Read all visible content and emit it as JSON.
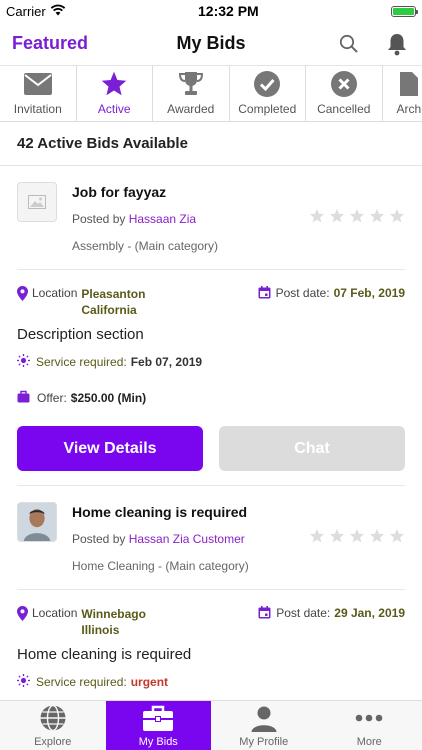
{
  "status": {
    "carrier": "Carrier",
    "time": "12:32 PM"
  },
  "nav": {
    "left": "Featured",
    "title": "My Bids"
  },
  "tabs": [
    {
      "label": "Invitation",
      "icon": "envelope-icon"
    },
    {
      "label": "Active",
      "icon": "star-icon"
    },
    {
      "label": "Awarded",
      "icon": "trophy-icon"
    },
    {
      "label": "Completed",
      "icon": "check-circle-icon"
    },
    {
      "label": "Cancelled",
      "icon": "x-circle-icon"
    },
    {
      "label": "Arch",
      "icon": "archive-icon"
    }
  ],
  "count_text": "42 Active Bids Available",
  "bids": [
    {
      "title": "Job for fayyaz",
      "posted_label": "Posted by",
      "poster": "Hassaan Zia",
      "category": "Assembly - (Main category)",
      "location_label": "Location",
      "location_line1": "Pleasanton",
      "location_line2": "California",
      "post_date_label": "Post date:",
      "post_date": "07 Feb, 2019",
      "description": "Description section",
      "service_label": "Service required:",
      "service_value": "Feb 07, 2019",
      "offer_label": "Offer:",
      "offer_value": "$250.00 (Min)",
      "view_label": "View Details",
      "chat_label": "Chat"
    },
    {
      "title": "Home cleaning is required",
      "posted_label": "Posted by",
      "poster": "Hassan Zia Customer",
      "category": "Home Cleaning - (Main category)",
      "location_label": "Location",
      "location_line1": "Winnebago",
      "location_line2": "Illinois",
      "post_date_label": "Post date:",
      "post_date": "29 Jan, 2019",
      "description": "Home cleaning is required",
      "service_label": "Service required:",
      "service_value": "urgent"
    }
  ],
  "tabbar": [
    {
      "label": "Explore",
      "icon": "globe-icon"
    },
    {
      "label": "My Bids",
      "icon": "briefcase-icon"
    },
    {
      "label": "My Profile",
      "icon": "person-icon"
    },
    {
      "label": "More",
      "icon": "dots-icon"
    }
  ],
  "colors": {
    "accent": "#7a06f0",
    "date_text": "#5a5a1a",
    "urgent": "#c0392b"
  }
}
